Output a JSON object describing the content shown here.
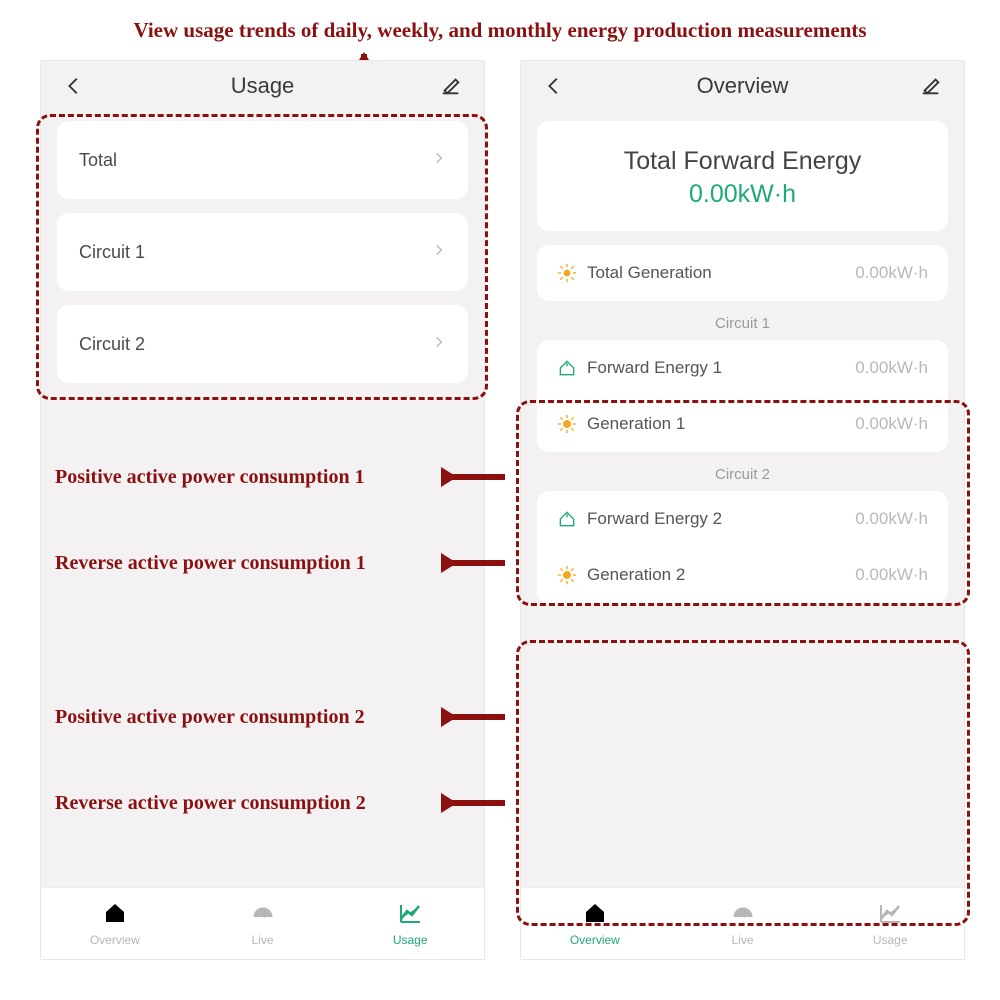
{
  "caption": "View usage trends of daily, weekly, and monthly energy production measurements",
  "annotations": {
    "fwd1": "Positive active power consumption 1",
    "gen1": "Reverse active power consumption 1",
    "fwd2": "Positive active power consumption 2",
    "gen2": "Reverse active power consumption 2"
  },
  "left_screen": {
    "title": "Usage",
    "items": [
      {
        "label": "Total"
      },
      {
        "label": "Circuit 1"
      },
      {
        "label": "Circuit 2"
      }
    ],
    "nav": {
      "overview": "Overview",
      "live": "Live",
      "usage": "Usage",
      "active": "usage"
    }
  },
  "right_screen": {
    "title": "Overview",
    "hero": {
      "label": "Total Forward Energy",
      "value": "0.00kW·h"
    },
    "total_generation": {
      "label": "Total Generation",
      "value": "0.00kW·h"
    },
    "section1": {
      "header": "Circuit 1",
      "fwd": {
        "label": "Forward Energy 1",
        "value": "0.00kW·h"
      },
      "gen": {
        "label": "Generation 1",
        "value": "0.00kW·h"
      }
    },
    "section2": {
      "header": "Circuit 2",
      "fwd": {
        "label": "Forward Energy 2",
        "value": "0.00kW·h"
      },
      "gen": {
        "label": "Generation 2",
        "value": "0.00kW·h"
      }
    },
    "nav": {
      "overview": "Overview",
      "live": "Live",
      "usage": "Usage",
      "active": "overview"
    }
  }
}
